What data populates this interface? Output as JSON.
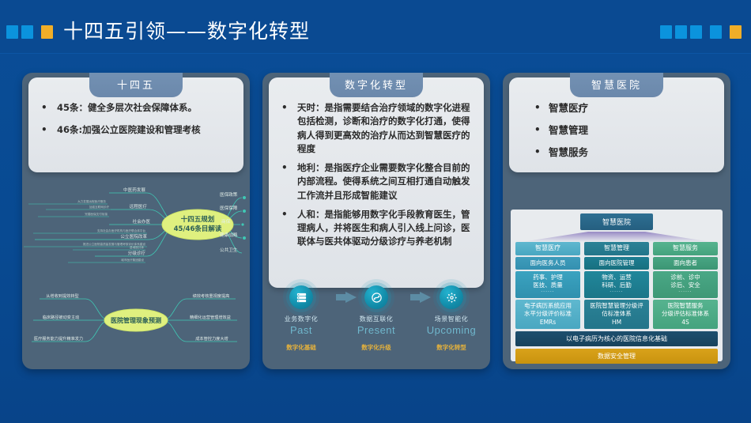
{
  "header": {
    "title": "十四五引领——数字化转型",
    "deco_left": [
      "blue",
      "blue",
      "gold"
    ],
    "deco_right": [
      "blue",
      "blue",
      "blue",
      "blue",
      "gold"
    ],
    "colors": {
      "blue": "#0b93dd",
      "gold": "#f0ae28",
      "background": "#0a4a92"
    }
  },
  "cards": [
    {
      "tab": "十四五",
      "bullets": [
        "45条：健全多层次社会保障体系。",
        "46条:加强公立医院建设和管理考核"
      ]
    },
    {
      "tab": "数字化转型",
      "bullets": [
        "天时：是指需要结合治疗领域的数字化进程包括检测，诊断和治疗的数字化打通，使得病人得到更高效的治疗从而达到智慧医疗的程度",
        "地利：是指医疗企业需要数字化整合目前的内部流程。使得系统之间互相打通自动触发工作流并且形成智能建议",
        "人和：是指能够用数字化手段教育医生，管理病人，并将医生和病人引入线上问诊，医联体与医共体驱动分级诊疗与养老机制"
      ]
    },
    {
      "tab": "智慧医院",
      "bullets": [
        "智慧医疗",
        "智慧管理",
        "智慧服务"
      ]
    }
  ],
  "mindmap_top": {
    "center": [
      "十四五规划",
      "45/46条目解读"
    ],
    "left_branches": [
      {
        "label": "中医药发展",
        "children": []
      },
      {
        "label": "远程医疗",
        "children": [
          "大力发展远程医疗服务",
          "加强互联网诊疗",
          "完善医保支付衔接"
        ]
      },
      {
        "label": "社会办医",
        "children": []
      },
      {
        "label": "公立医院改革",
        "children": [
          "支持社会办医疗机构与医疗联合体平台",
          "推进公立医院高质量发展与管理考核评价体系建设"
        ]
      },
      {
        "label": "分级诊疗",
        "children": [
          "县域医共体",
          "城市医疗集团建设"
        ]
      }
    ],
    "right_branches": [
      "医保政策",
      "医保保障",
      "商保",
      "健康战略",
      "公共卫生"
    ]
  },
  "mindmap_bottom": {
    "center": "医院管理现象预测",
    "left_branches": [
      "从增收到提效转型",
      "临床路径被动变主动",
      "医疗服务能力提升精准发力"
    ],
    "right_branches": [
      "绩效考核重视度提高",
      "精细化运营管理增效益",
      "成本管控力度大增"
    ]
  },
  "steps": [
    {
      "cn": "业务数字化",
      "en": "Past",
      "tag": "数字化基础",
      "icon": "server-icon"
    },
    {
      "cn": "数据互联化",
      "en": "Present",
      "tag": "数字化升级",
      "icon": "network-icon"
    },
    {
      "cn": "场景智能化",
      "en": "Upcoming",
      "tag": "数字化转型",
      "icon": "gear-star-icon"
    }
  ],
  "diagram": {
    "top": "智慧医院",
    "columns": [
      {
        "head": "智慧医疗",
        "sub": "面向医务人员",
        "detail_lines": [
          "药事、护理",
          "医技、质量"
        ],
        "dots": "······",
        "standard": [
          "电子病历系统应用",
          "水平分级评价标准",
          "EMRs"
        ]
      },
      {
        "head": "智慧管理",
        "sub": "面向医院管理",
        "detail_lines": [
          "物资、运营",
          "科研、后勤"
        ],
        "dots": "······",
        "standard": [
          "医院智慧管理分级评",
          "估标准体系",
          "HM"
        ]
      },
      {
        "head": "智慧服务",
        "sub": "面向患者",
        "detail_lines": [
          "诊前、诊中",
          "诊后、安全"
        ],
        "dots": "······",
        "standard": [
          "医院智慧服务",
          "分级评估标准体系",
          "4S"
        ]
      }
    ],
    "base": "以电子病历为核心的医院信息化基础",
    "security": "数据安全管理"
  }
}
